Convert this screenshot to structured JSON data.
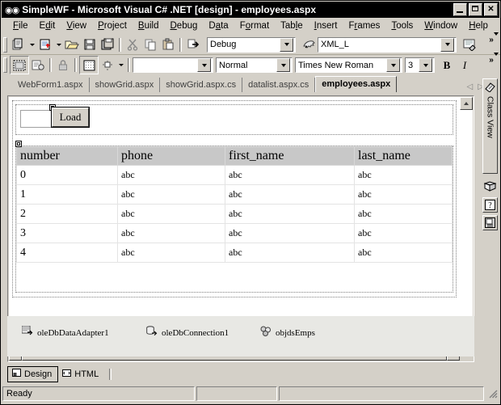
{
  "window": {
    "title": "SimpleWF - Microsoft Visual C# .NET [design] - employees.aspx",
    "app_icon": "visual-studio-icon",
    "minimize_label": "_",
    "maximize_label": "□",
    "close_label": "✕"
  },
  "menu": {
    "items": [
      {
        "label": "File",
        "accel": "F"
      },
      {
        "label": "Edit",
        "accel": "E"
      },
      {
        "label": "View",
        "accel": "V"
      },
      {
        "label": "Project",
        "accel": "P"
      },
      {
        "label": "Build",
        "accel": "B"
      },
      {
        "label": "Debug",
        "accel": "D"
      },
      {
        "label": "Data",
        "accel": "a"
      },
      {
        "label": "Format",
        "accel": "o"
      },
      {
        "label": "Table",
        "accel": "l"
      },
      {
        "label": "Insert",
        "accel": "I"
      },
      {
        "label": "Frames",
        "accel": "r"
      },
      {
        "label": "Tools",
        "accel": "T"
      },
      {
        "label": "Window",
        "accel": "W"
      },
      {
        "label": "Help",
        "accel": "H"
      }
    ]
  },
  "toolbar_standard": {
    "buttons": [
      {
        "name": "new-project-icon",
        "tooltip": "New Project"
      },
      {
        "name": "add-new-item-icon",
        "tooltip": "Add New Item"
      },
      {
        "name": "open-file-icon",
        "tooltip": "Open File"
      },
      {
        "name": "save-icon",
        "tooltip": "Save"
      },
      {
        "name": "save-all-icon",
        "tooltip": "Save All"
      },
      {
        "name": "cut-icon",
        "tooltip": "Cut"
      },
      {
        "name": "copy-icon",
        "tooltip": "Copy"
      },
      {
        "name": "paste-icon",
        "tooltip": "Paste"
      },
      {
        "name": "start-debug-icon",
        "tooltip": "Start"
      }
    ],
    "config_combo": {
      "value": "Debug",
      "name": "solution-configuration"
    },
    "find_combo": {
      "value": "XML_L",
      "name": "find-combo"
    },
    "solution_explorer_icon": "solution-explorer-icon",
    "overflow_label": "»"
  },
  "toolbar_formatting": {
    "buttons": [
      {
        "name": "show-borders-icon",
        "tooltip": "Show Borders"
      },
      {
        "name": "show-details-icon",
        "tooltip": "Show Details"
      },
      {
        "name": "lock-icon",
        "tooltip": "Lock Elements"
      },
      {
        "name": "show-grid-icon",
        "tooltip": "Show Grid"
      },
      {
        "name": "snap-to-grid-icon",
        "tooltip": "Snap to Grid"
      }
    ],
    "style_combo": {
      "value": "",
      "name": "style-combo"
    },
    "block_format_combo": {
      "value": "Normal",
      "name": "block-format-combo"
    },
    "font_combo": {
      "value": "Times New Roman",
      "name": "font-name-combo"
    },
    "size_combo": {
      "value": "3",
      "name": "font-size-combo"
    },
    "bold_label": "B",
    "italic_label": "I",
    "overflow_label": "»"
  },
  "document_tabs": {
    "items": [
      {
        "label": "WebForm1.aspx",
        "active": false
      },
      {
        "label": "showGrid.aspx",
        "active": false
      },
      {
        "label": "showGrid.aspx.cs",
        "active": false
      },
      {
        "label": "datalist.aspx.cs",
        "active": false
      },
      {
        "label": "employees.aspx",
        "active": true
      }
    ],
    "nav_prev": "◁",
    "nav_next": "▷",
    "close_label": "✕"
  },
  "designer": {
    "textbox": {
      "value": "",
      "name": "employee-textbox"
    },
    "load_button": {
      "label": "Load",
      "name": "load-button"
    },
    "grid": {
      "columns": [
        "number",
        "phone",
        "first_name",
        "last_name"
      ],
      "rows": [
        [
          "0",
          "abc",
          "abc",
          "abc"
        ],
        [
          "1",
          "abc",
          "abc",
          "abc"
        ],
        [
          "2",
          "abc",
          "abc",
          "abc"
        ],
        [
          "3",
          "abc",
          "abc",
          "abc"
        ],
        [
          "4",
          "abc",
          "abc",
          "abc"
        ]
      ],
      "header_bg": "#c8c8c8"
    }
  },
  "component_tray": {
    "items": [
      {
        "label": "oleDbDataAdapter1",
        "icon": "data-adapter-icon"
      },
      {
        "label": "oleDbConnection1",
        "icon": "db-connection-icon"
      },
      {
        "label": "objdsEmps",
        "icon": "dataset-icon"
      }
    ]
  },
  "view_tabs": {
    "items": [
      {
        "label": "Design",
        "icon": "design-view-icon",
        "active": true
      },
      {
        "label": "HTML",
        "icon": "html-view-icon",
        "active": false
      }
    ]
  },
  "status_bar": {
    "message": "Ready",
    "panel2": "",
    "panel3": ""
  },
  "right_dock": {
    "class_view_label": "Class View",
    "tabs": [
      {
        "label": "Class View",
        "icon": "class-view-icon"
      }
    ],
    "icons": [
      {
        "name": "object-browser-icon"
      },
      {
        "name": "dynamic-help-icon"
      },
      {
        "name": "properties-window-icon"
      }
    ]
  },
  "colors": {
    "titlebar_bg": "#000000",
    "chrome_bg": "#d4d0c8",
    "canvas_bg": "#ffffff",
    "grid_header_bg": "#c8c8c8",
    "tray_bg": "#e8e8e4"
  }
}
